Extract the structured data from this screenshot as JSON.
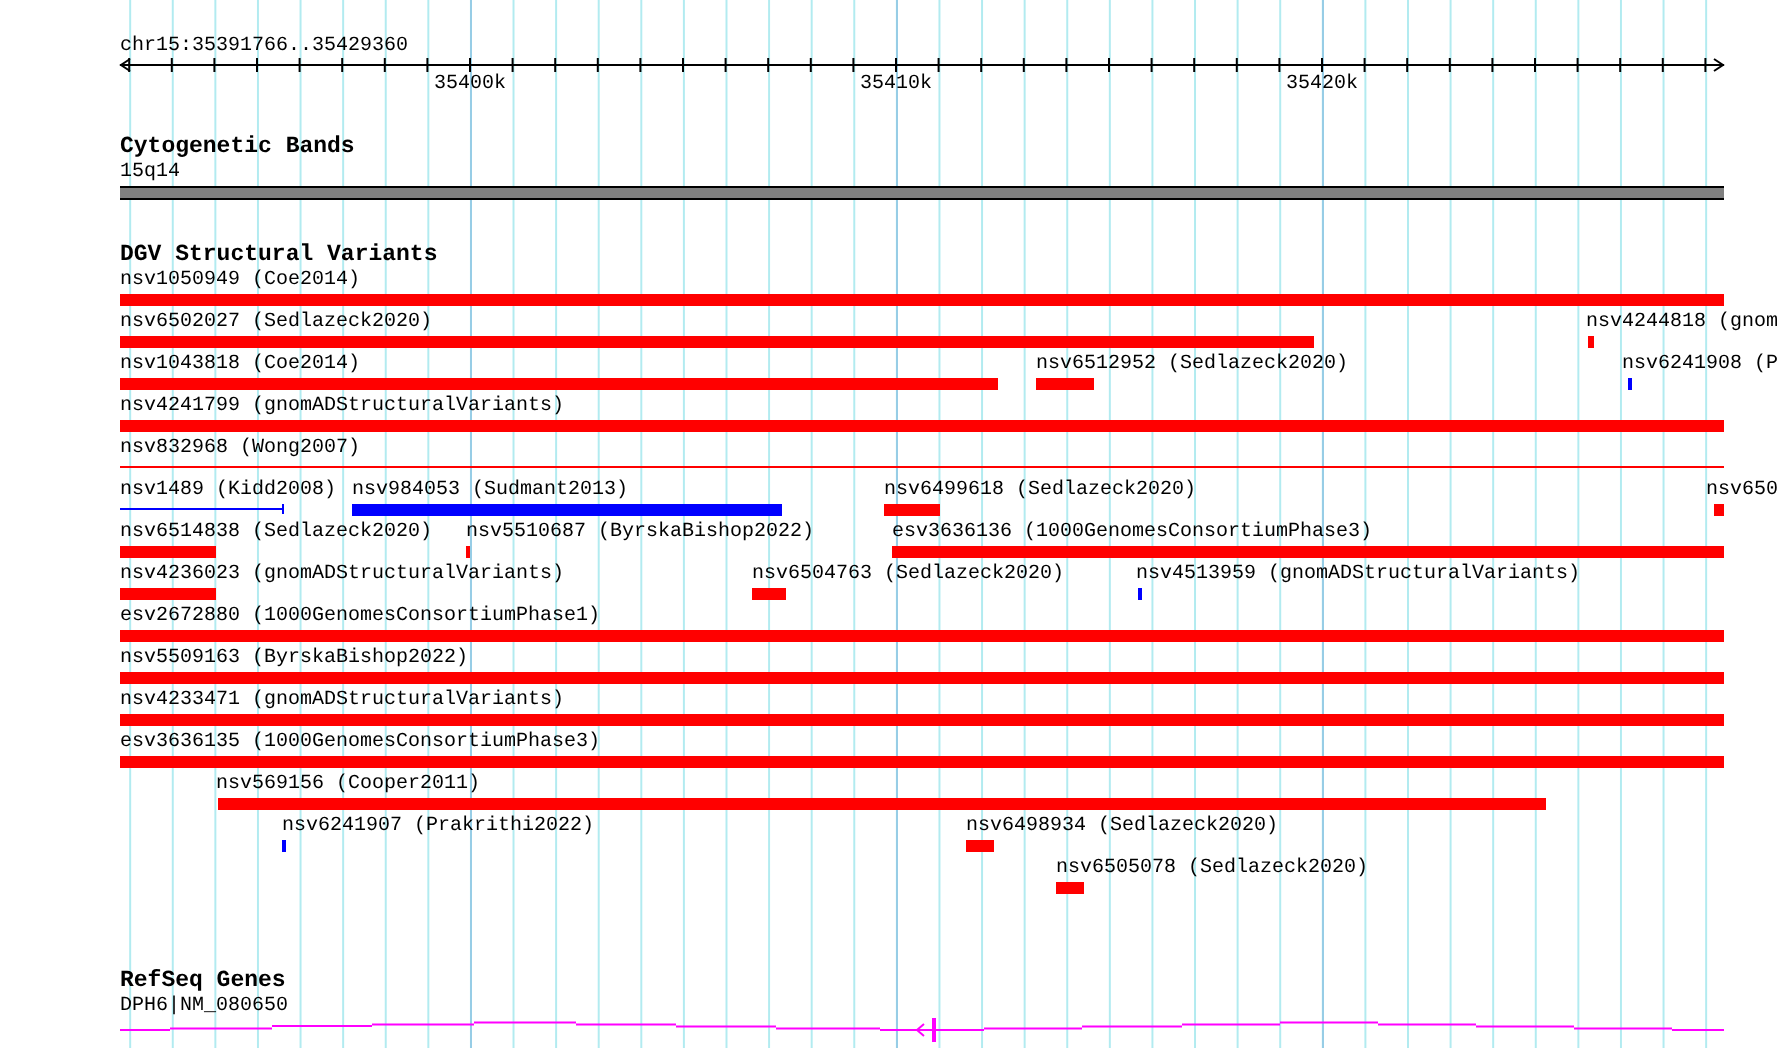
{
  "ruler": {
    "location": "chr15:35391766..35429360",
    "ticks": [
      "35400k",
      "35410k",
      "35420k"
    ]
  },
  "tracks": [
    {
      "kind": "cytoband",
      "title": "Cytogenetic Bands",
      "band": "15q14"
    },
    {
      "kind": "variants",
      "title": "DGV Structural Variants",
      "rows": [
        {
          "features": [
            {
              "label": "nsv1050949 (Coe2014)",
              "kind": "bar",
              "color": "#ff0000"
            }
          ]
        },
        {
          "features": [
            {
              "label": "nsv6502027 (Sedlazeck2020)",
              "kind": "bar",
              "color": "#ff0000"
            },
            {
              "label": "nsv4244818 (gnom",
              "kind": "bar",
              "color": "#ff0000"
            }
          ]
        },
        {
          "features": [
            {
              "label": "nsv1043818 (Coe2014)",
              "kind": "bar",
              "color": "#ff0000"
            },
            {
              "label": "nsv6512952 (Sedlazeck2020)",
              "kind": "bar",
              "color": "#ff0000"
            },
            {
              "label": "nsv6241908 (P",
              "kind": "bar",
              "color": "#0000ff"
            }
          ]
        },
        {
          "features": [
            {
              "label": "nsv4241799 (gnomADStructuralVariants)",
              "kind": "bar",
              "color": "#ff0000"
            }
          ]
        },
        {
          "features": [
            {
              "label": "nsv832968 (Wong2007)",
              "kind": "line",
              "color": "#ff0000"
            }
          ]
        },
        {
          "features": [
            {
              "label": "nsv1489 (Kidd2008)",
              "kind": "capped-line",
              "color": "#0000ff"
            },
            {
              "label": "nsv984053 (Sudmant2013)",
              "kind": "bar",
              "color": "#0000ff"
            },
            {
              "label": "nsv6499618 (Sedlazeck2020)",
              "kind": "bar",
              "color": "#ff0000"
            },
            {
              "label": "nsv650",
              "kind": "bar",
              "color": "#ff0000"
            }
          ]
        },
        {
          "features": [
            {
              "label": "nsv6514838 (Sedlazeck2020)",
              "kind": "bar",
              "color": "#ff0000"
            },
            {
              "label": "nsv5510687 (ByrskaBishop2022)",
              "kind": "bar",
              "color": "#ff0000"
            },
            {
              "label": "esv3636136 (1000GenomesConsortiumPhase3)",
              "kind": "bar",
              "color": "#ff0000"
            }
          ]
        },
        {
          "features": [
            {
              "label": "nsv4236023 (gnomADStructuralVariants)",
              "kind": "bar",
              "color": "#ff0000"
            },
            {
              "label": "nsv6504763 (Sedlazeck2020)",
              "kind": "bar",
              "color": "#ff0000"
            },
            {
              "label": "nsv4513959 (gnomADStructuralVariants)",
              "kind": "bar",
              "color": "#0000ff"
            }
          ]
        },
        {
          "features": [
            {
              "label": "esv2672880 (1000GenomesConsortiumPhase1)",
              "kind": "bar",
              "color": "#ff0000"
            }
          ]
        },
        {
          "features": [
            {
              "label": "nsv5509163 (ByrskaBishop2022)",
              "kind": "bar",
              "color": "#ff0000"
            }
          ]
        },
        {
          "features": [
            {
              "label": "nsv4233471 (gnomADStructuralVariants)",
              "kind": "bar",
              "color": "#ff0000"
            }
          ]
        },
        {
          "features": [
            {
              "label": "esv3636135 (1000GenomesConsortiumPhase3)",
              "kind": "bar",
              "color": "#ff0000"
            }
          ]
        },
        {
          "features": [
            {
              "label": "nsv569156 (Cooper2011)",
              "kind": "bar",
              "color": "#ff0000"
            }
          ]
        },
        {
          "features": [
            {
              "label": "nsv6241907 (Prakrithi2022)",
              "kind": "bar",
              "color": "#0000ff"
            },
            {
              "label": "nsv6498934 (Sedlazeck2020)",
              "kind": "bar",
              "color": "#ff0000"
            }
          ]
        },
        {
          "features": [
            {
              "label": "nsv6505078 (Sedlazeck2020)",
              "kind": "bar",
              "color": "#ff0000"
            }
          ]
        }
      ]
    },
    {
      "kind": "genes",
      "title": "RefSeq Genes",
      "gene": "DPH6|NM_080650"
    }
  ]
}
